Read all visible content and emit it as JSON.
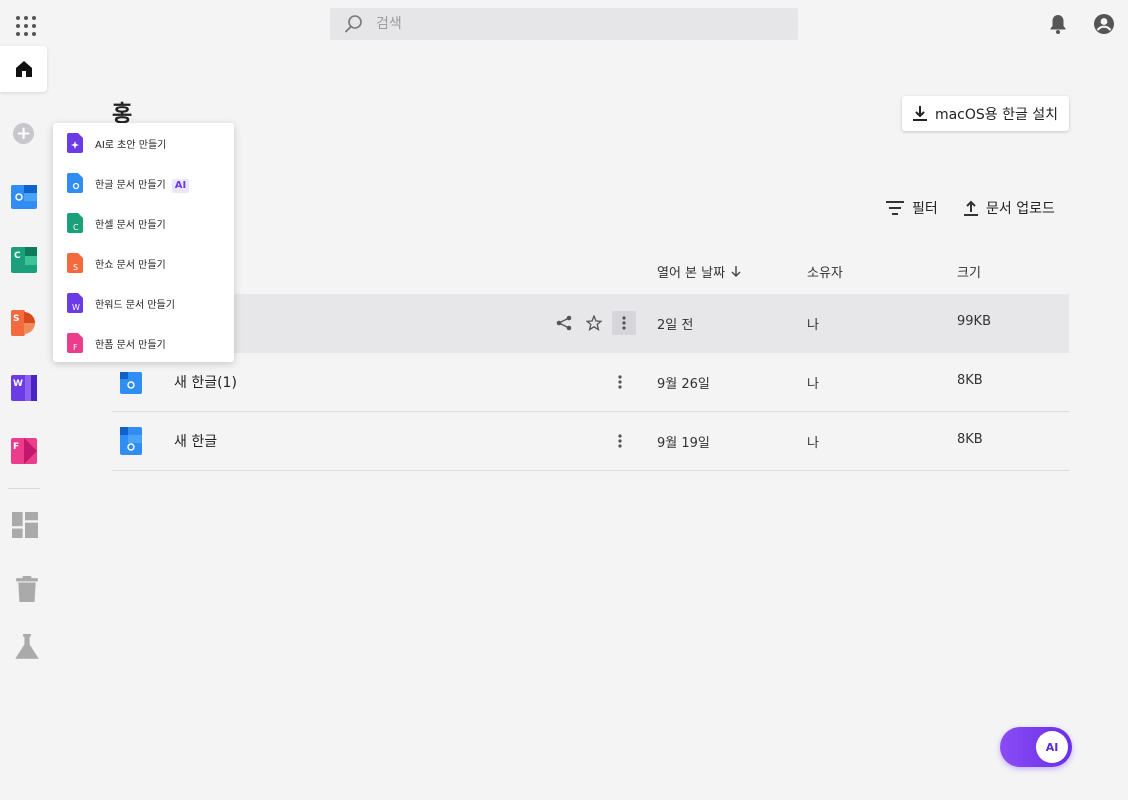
{
  "header": {
    "search_placeholder": "검색"
  },
  "page": {
    "title": "홍",
    "install_label": "macOS용 한글 설치",
    "filter_label": "필터",
    "upload_label": "문서 업로드"
  },
  "table": {
    "columns": {
      "date": "열어 본 날짜",
      "owner": "소유자",
      "size": "크기"
    },
    "rows": [
      {
        "name": "",
        "date": "2일 전",
        "owner": "나",
        "size": "99KB"
      },
      {
        "name": "새 한글(1)",
        "date": "9월 26일",
        "owner": "나",
        "size": "8KB"
      },
      {
        "name": "새 한글",
        "date": "9월 19일",
        "owner": "나",
        "size": "8KB"
      }
    ]
  },
  "menu": {
    "items": [
      {
        "label": "AI로 초안 만들기",
        "color": "#6b3ce6"
      },
      {
        "label": "한글 문서 만들기",
        "badge": "AI",
        "color": "#2f8df3"
      },
      {
        "label": "한셀 문서 만들기",
        "color": "#1aa07a"
      },
      {
        "label": "한쇼 문서 만들기",
        "color": "#f26a3d"
      },
      {
        "label": "한워드 문서 만들기",
        "color": "#6b3ce6"
      },
      {
        "label": "한폼 문서 만들기",
        "color": "#ec3d8d"
      }
    ]
  },
  "sidebar": {
    "app_letters": {
      "hancell": "C",
      "hanshow": "S",
      "hanword": "W",
      "hanform": "F"
    }
  },
  "fab": {
    "label": "AI"
  }
}
